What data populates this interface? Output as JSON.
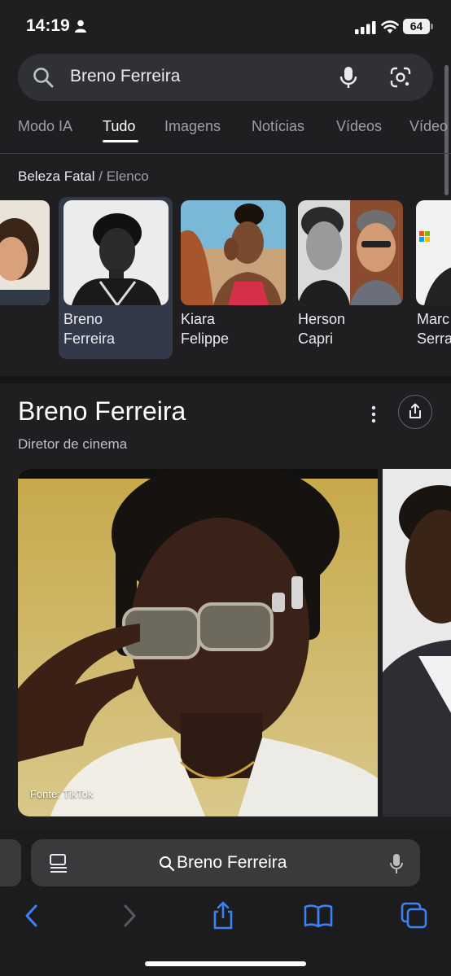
{
  "status_bar": {
    "time": "14:19",
    "battery": "64"
  },
  "search": {
    "query": "Breno Ferreira"
  },
  "tabs": [
    {
      "label": "Modo IA",
      "active": false
    },
    {
      "label": "Tudo",
      "active": true
    },
    {
      "label": "Imagens",
      "active": false
    },
    {
      "label": "Notícias",
      "active": false
    },
    {
      "label": "Vídeos",
      "active": false
    },
    {
      "label": "Vídeo",
      "active": false
    }
  ],
  "breadcrumb": {
    "main": "Beleza Fatal",
    "separator": "/",
    "sub": "Elenco"
  },
  "cast": [
    {
      "name": ""
    },
    {
      "name": "Breno\nFerreira",
      "selected": true
    },
    {
      "name": "Kiara\nFelippe"
    },
    {
      "name": "Herson\nCapri"
    },
    {
      "name": "Marc\nSerra"
    }
  ],
  "knowledge_panel": {
    "title": "Breno Ferreira",
    "subtitle": "Diretor de cinema",
    "photo_source": "Fonte: TikTok"
  },
  "safari": {
    "address": "Breno Ferreira"
  },
  "colors": {
    "background": "#1f1f21",
    "accent_blue": "#3b82f6",
    "selected_card": "#34394a"
  }
}
